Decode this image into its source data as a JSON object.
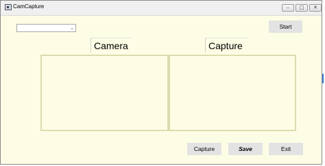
{
  "window": {
    "title": "CamCapture",
    "min_icon": "minimize-icon",
    "max_icon": "maximize-icon",
    "close_icon": "close-icon"
  },
  "controls": {
    "camera_select_value": "",
    "start_label": "Start",
    "camera_label": "Camera",
    "capture_label": "Capture",
    "capture_button_label": "Capture",
    "save_label": "Save",
    "exit_label": "Exit"
  },
  "colors": {
    "background": "#fdfde5",
    "panel_border": "#dadcae",
    "button": "#e3e3e3"
  }
}
